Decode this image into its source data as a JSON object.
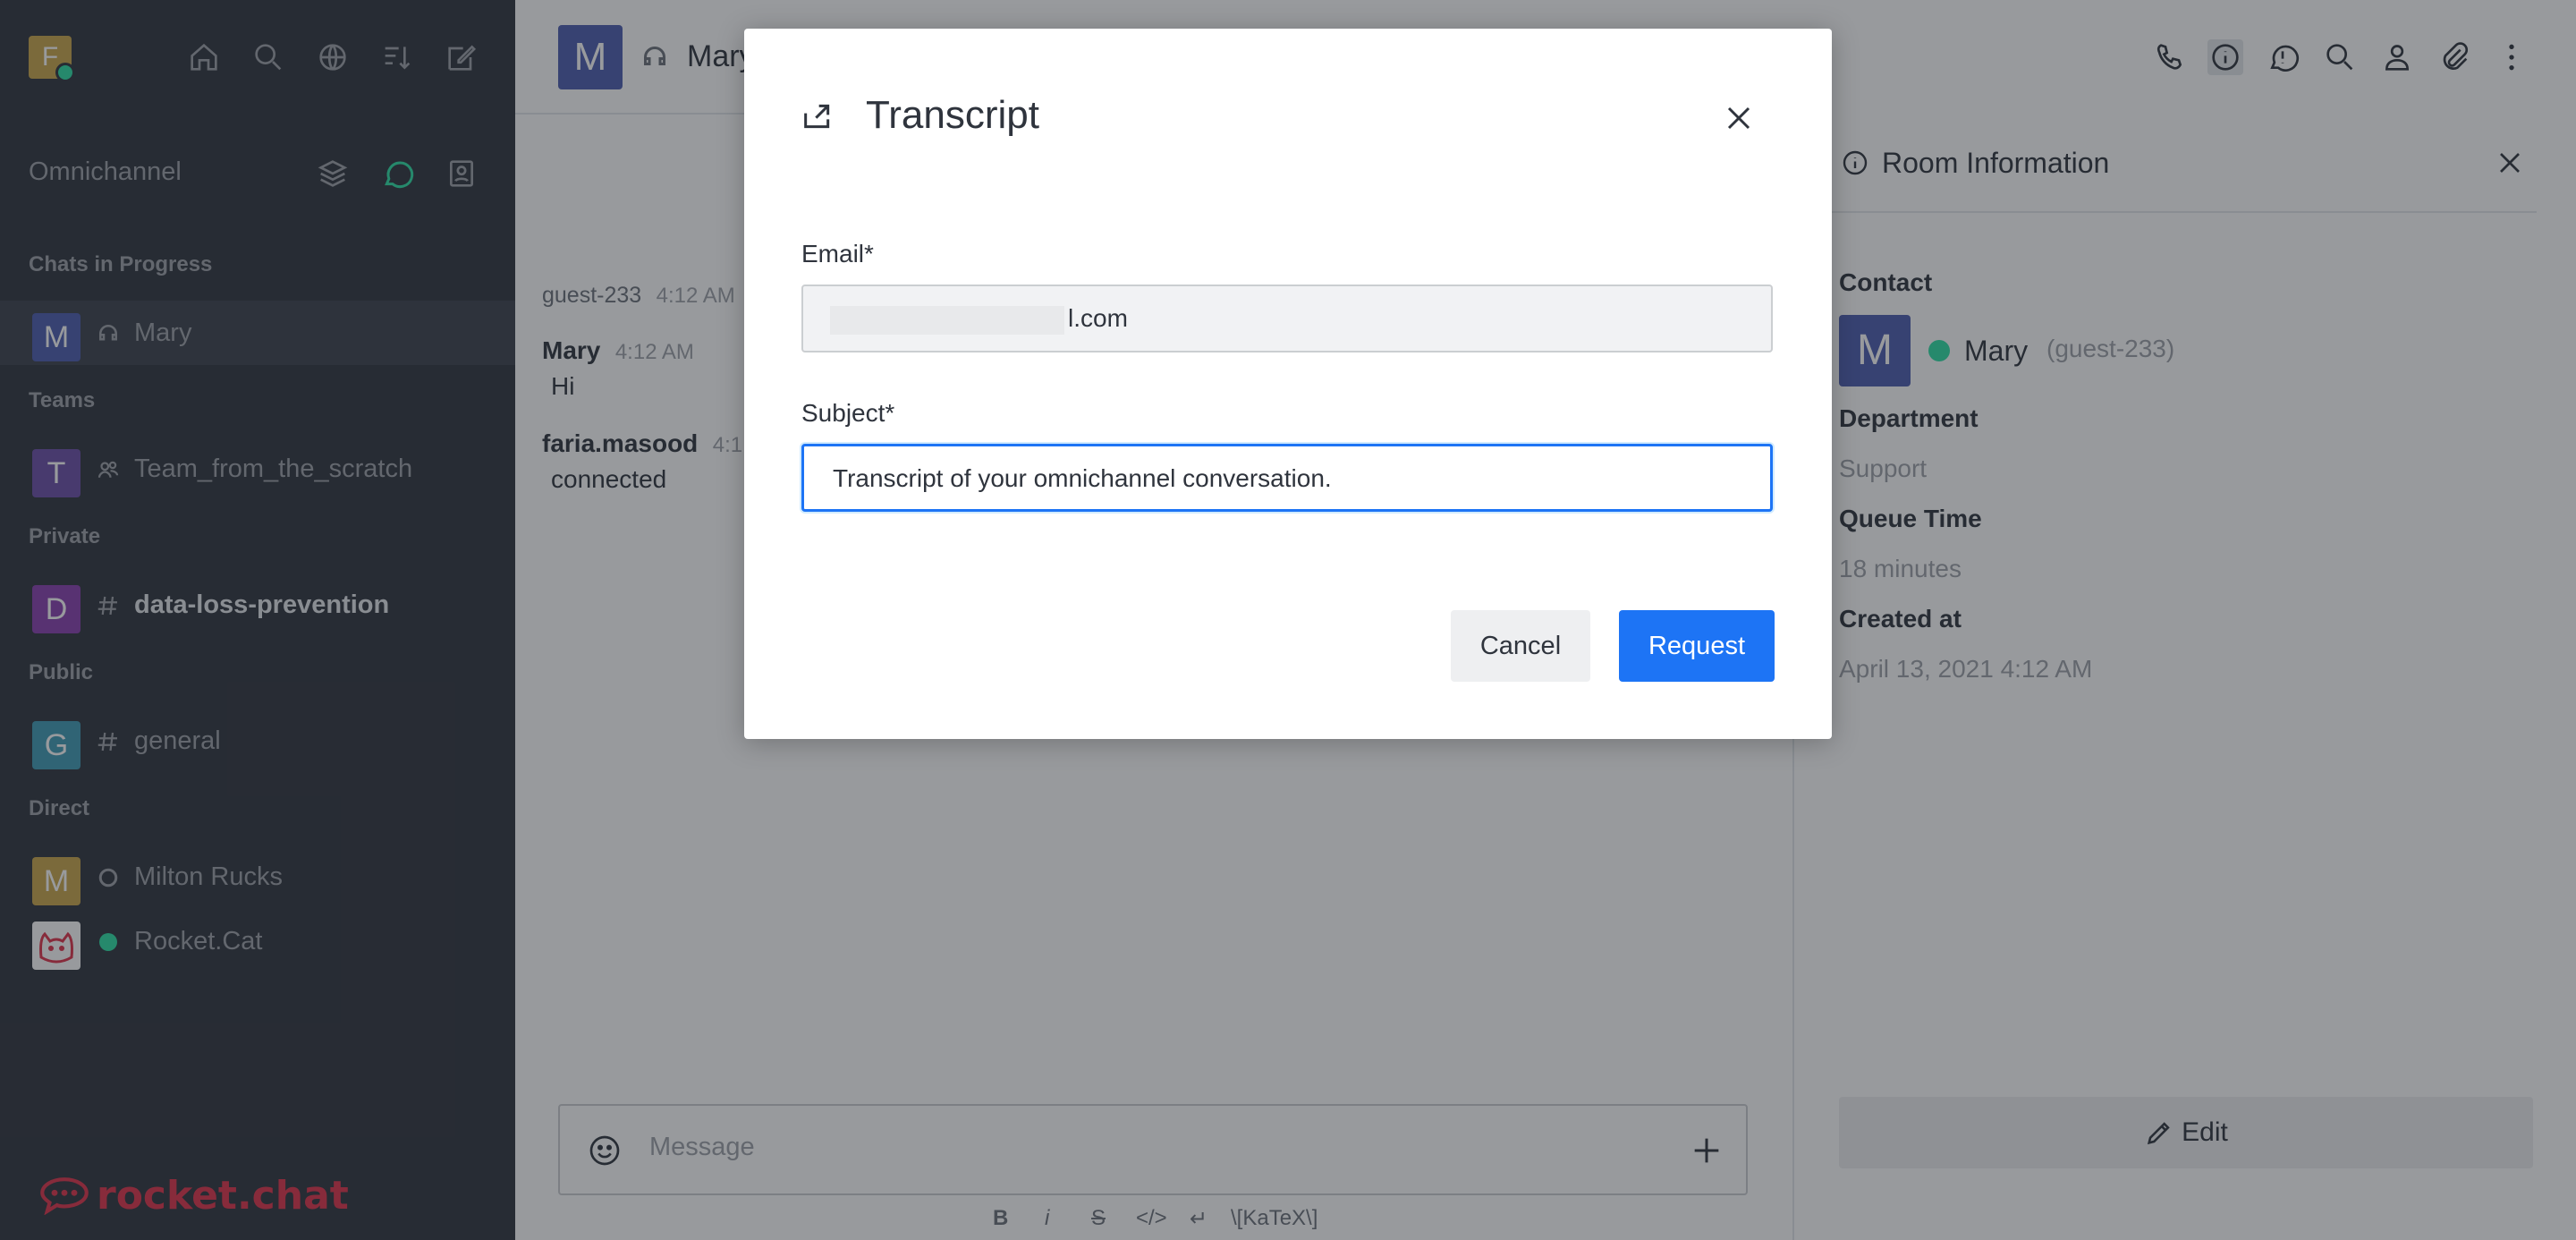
{
  "sidebar": {
    "user_avatar_letter": "F",
    "section_header": "Omnichannel",
    "groups": [
      {
        "title": "Chats in Progress",
        "rooms": [
          {
            "letter": "M",
            "name": "Mary",
            "color": "#4d5db0",
            "icon": "headset-icon"
          }
        ]
      },
      {
        "title": "Teams",
        "rooms": [
          {
            "letter": "T",
            "name": "Team_from_the_scratch",
            "color": "#6c4fa8",
            "icon": "team-icon"
          }
        ]
      },
      {
        "title": "Private",
        "rooms": [
          {
            "letter": "D",
            "name": "data-loss-prevention",
            "color": "#8a3fb0",
            "icon": "hashtag-icon"
          }
        ]
      },
      {
        "title": "Public",
        "rooms": [
          {
            "letter": "G",
            "name": "general",
            "color": "#3f9bb5",
            "icon": "hashtag-icon"
          }
        ]
      },
      {
        "title": "Direct",
        "rooms": [
          {
            "letter": "M",
            "name": "Milton Rucks",
            "color": "#c9a74a",
            "icon": "status-offline-icon"
          },
          {
            "letter": "",
            "name": "Rocket.Cat",
            "color": "#ffffff",
            "icon": "status-online-icon"
          }
        ]
      }
    ],
    "brand": "rocket.chat"
  },
  "room_header": {
    "avatar_letter": "M",
    "title": "Mary"
  },
  "messages": [
    {
      "user": "guest-233",
      "time": "4:12 AM",
      "text": ""
    },
    {
      "user": "Mary",
      "time": "4:12 AM",
      "text": "Hi"
    },
    {
      "user": "faria.masood",
      "time": "4:1",
      "text": "connected"
    }
  ],
  "composer": {
    "placeholder": "Message",
    "toolbar": [
      "B",
      "i",
      "S",
      "</>",
      "↵",
      "\\[KaTeX\\]"
    ]
  },
  "room_info": {
    "title": "Room Information",
    "contact_label": "Contact",
    "contact_avatar": "M",
    "contact_name": "Mary",
    "contact_username": "(guest-233)",
    "department_label": "Department",
    "department_value": "Support",
    "queue_label": "Queue Time",
    "queue_value": "18 minutes",
    "created_label": "Created at",
    "created_value": "April 13, 2021 4:12 AM",
    "edit_label": "Edit"
  },
  "modal": {
    "title": "Transcript",
    "email_label": "Email*",
    "email_value": "l.com",
    "subject_label": "Subject*",
    "subject_value": "Transcript of your omnichannel conversation.",
    "cancel_label": "Cancel",
    "request_label": "Request"
  },
  "colors": {
    "sidebar_bg": "#2f343d",
    "primary": "#1d74f5",
    "online": "#2de0a5"
  }
}
